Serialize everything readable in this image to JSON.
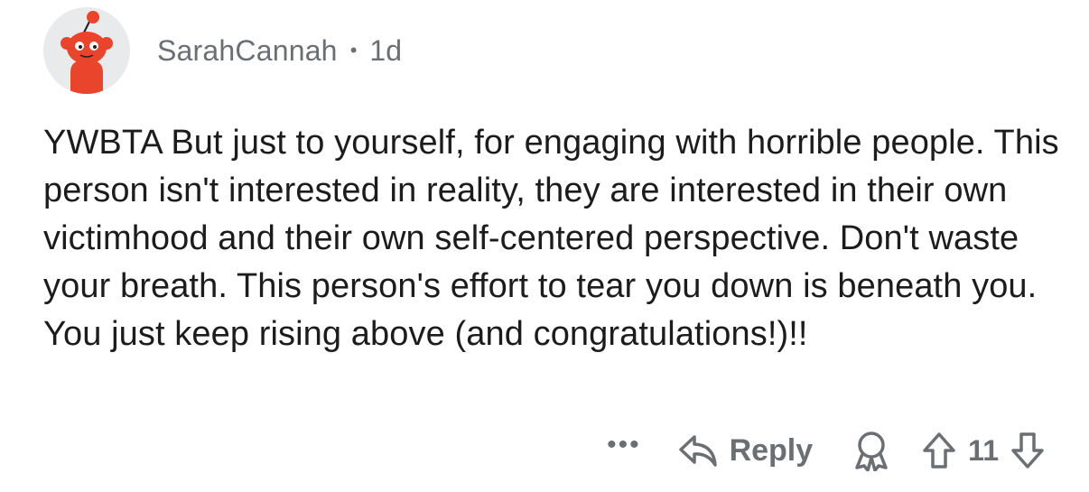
{
  "comment": {
    "username": "SarahCannah",
    "separator": "•",
    "age": "1d",
    "body": "YWBTA But just to yourself, for engaging with horrible people. This person isn't interested in reality, they are interested in their own victimhood and their own self-centered perspective. Don't waste your breath. This person's effort to tear you down is beneath you. You just keep rising above (and congratulations!)!!",
    "more_label": "•••",
    "reply_label": "Reply",
    "score": "11"
  },
  "icons": {
    "avatar": "reddit-snoo-avatar",
    "more": "more-options-icon",
    "reply": "reply-arrow-icon",
    "award": "award-icon",
    "upvote": "upvote-arrow-icon",
    "downvote": "downvote-arrow-icon"
  },
  "colors": {
    "avatar_bg": "#e9eaec",
    "snoo": "#e8452c",
    "meta_text": "#6b6f73",
    "body_text": "#1c1c1c"
  }
}
